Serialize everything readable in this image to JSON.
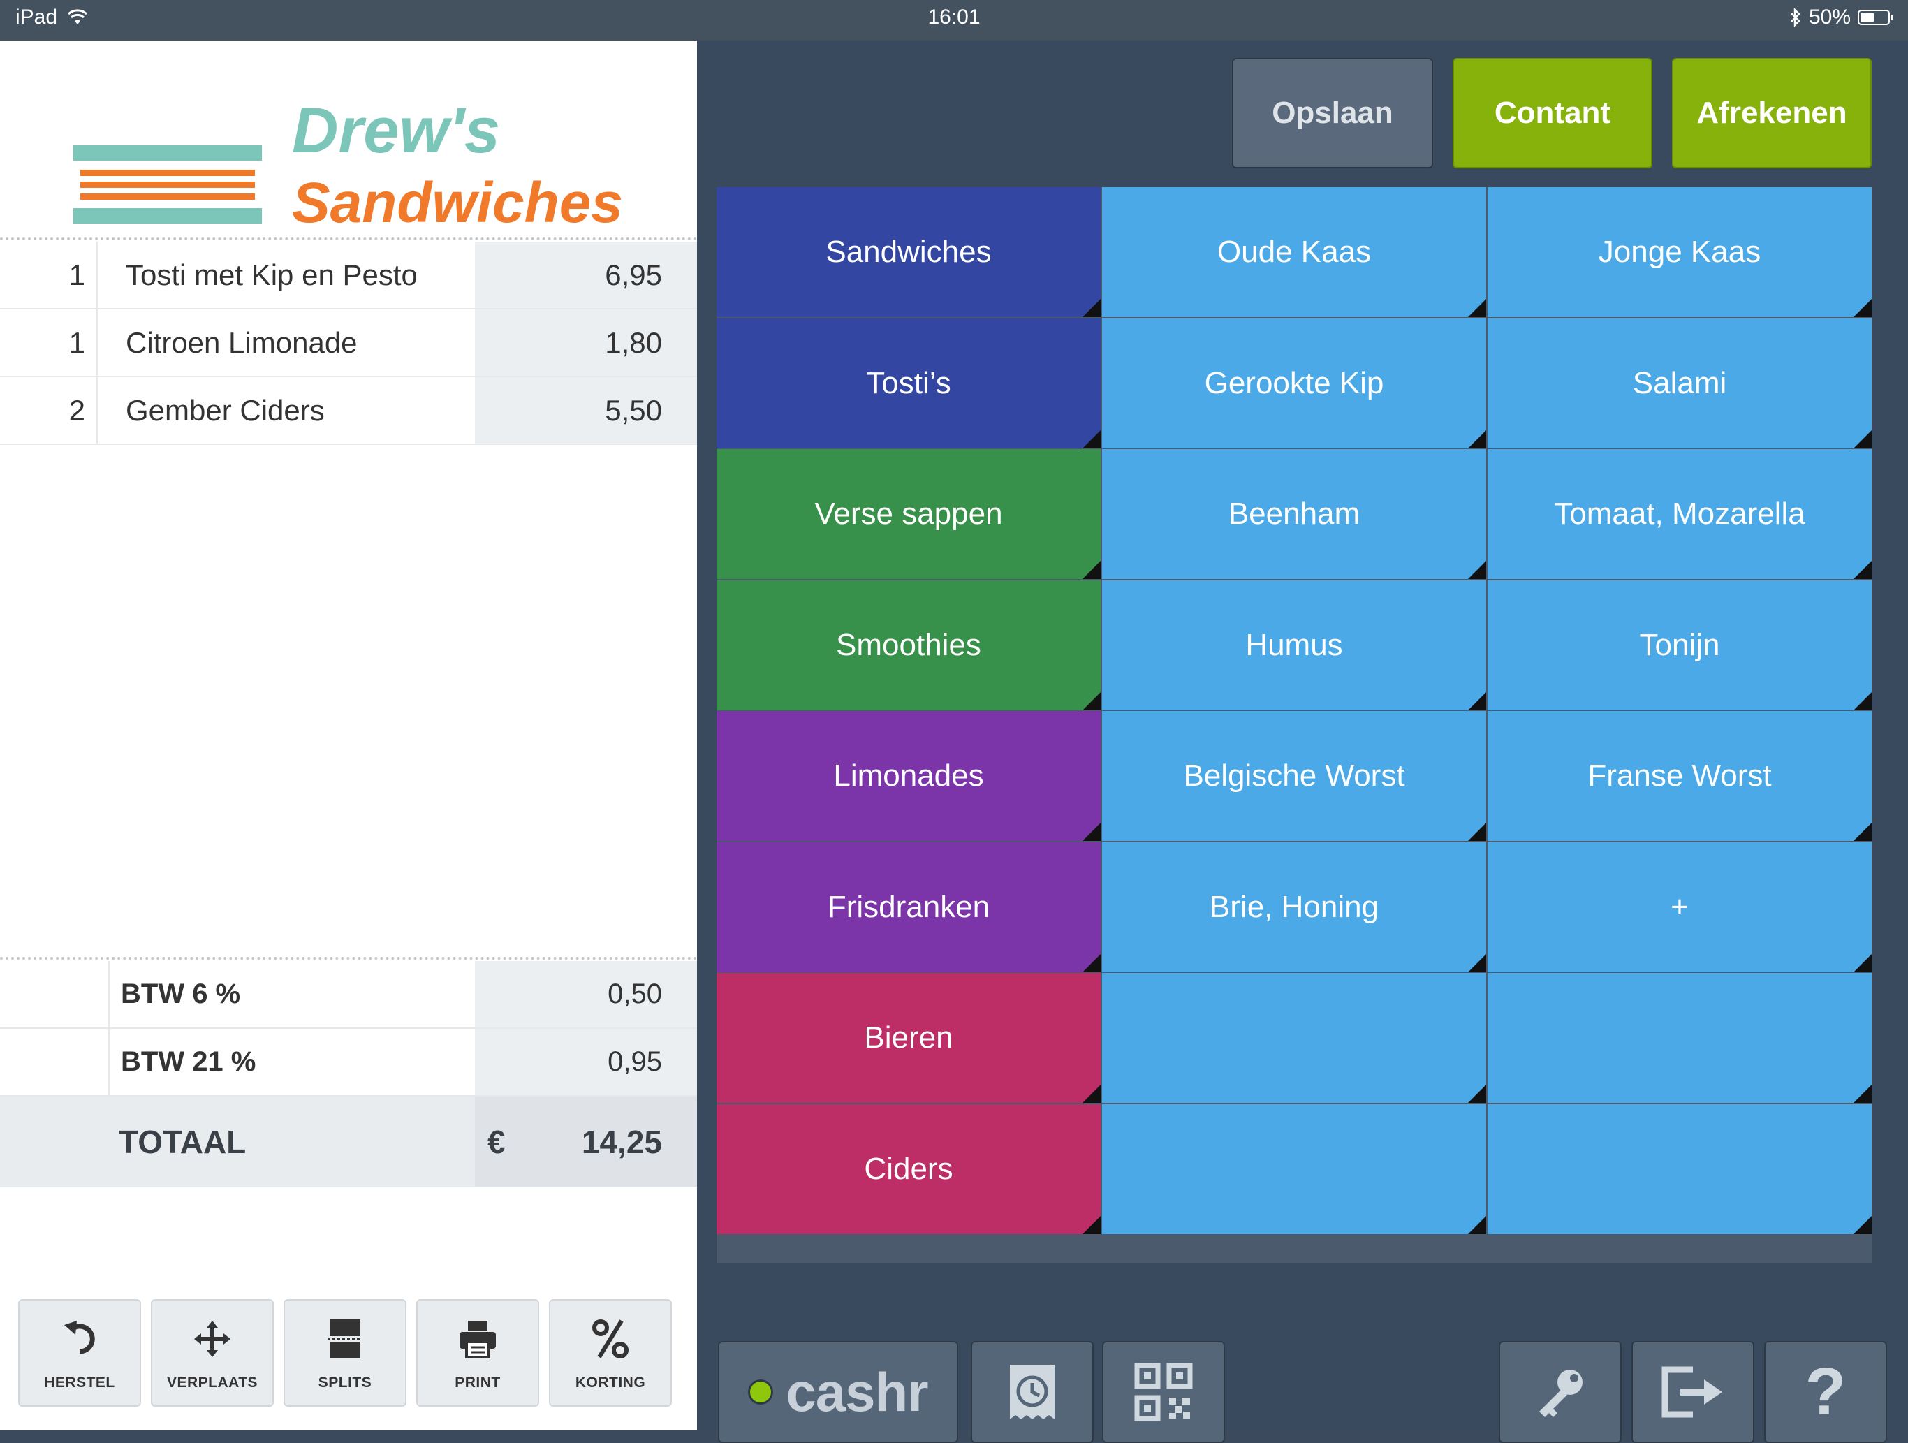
{
  "status_bar": {
    "device": "iPad",
    "time": "16:01",
    "battery": "50%",
    "battery_level": 0.5
  },
  "logo": {
    "line1": "Drew's",
    "line2": "Sandwiches"
  },
  "order_items": [
    {
      "qty": "1",
      "name": "Tosti met Kip en Pesto",
      "price": "6,95"
    },
    {
      "qty": "1",
      "name": "Citroen Limonade",
      "price": "1,80"
    },
    {
      "qty": "2",
      "name": "Gember Ciders",
      "price": "5,50"
    }
  ],
  "tax_rows": [
    {
      "label": "BTW 6 %",
      "value": "0,50"
    },
    {
      "label": "BTW 21 %",
      "value": "0,95"
    }
  ],
  "total": {
    "label": "TOTAAL",
    "currency": "€",
    "amount": "14,25"
  },
  "tools": [
    {
      "label": "HERSTEL",
      "icon": "undo-icon"
    },
    {
      "label": "VERPLAATS",
      "icon": "move-icon"
    },
    {
      "label": "SPLITS",
      "icon": "split-icon"
    },
    {
      "label": "PRINT",
      "icon": "printer-icon"
    },
    {
      "label": "KORTING",
      "icon": "percent-icon"
    }
  ],
  "actions": {
    "save": "Opslaan",
    "cash": "Contant",
    "checkout": "Afrekenen"
  },
  "categories": [
    {
      "label": "Sandwiches",
      "color": "#3347a2"
    },
    {
      "label": "Tosti’s",
      "color": "#3347a2"
    },
    {
      "label": "Verse sappen",
      "color": "#38914a"
    },
    {
      "label": "Smoothies",
      "color": "#38914a"
    },
    {
      "label": "Limonades",
      "color": "#7c35a8"
    },
    {
      "label": "Frisdranken",
      "color": "#7c35a8"
    },
    {
      "label": "Bieren",
      "color": "#bd2d66"
    },
    {
      "label": "Ciders",
      "color": "#bd2d66"
    }
  ],
  "products": [
    [
      "Oude Kaas",
      "Jonge Kaas"
    ],
    [
      "Gerookte Kip",
      "Salami"
    ],
    [
      "Beenham",
      "Tomaat, Mozarella"
    ],
    [
      "Humus",
      "Tonijn"
    ],
    [
      "Belgische Worst",
      "Franse Worst"
    ],
    [
      "Brie, Honing",
      "+"
    ],
    [
      "",
      ""
    ],
    [
      "",
      ""
    ]
  ],
  "product_color": "#4aa9e6",
  "bottom": {
    "brand": "cashr",
    "icons": [
      "receipt-clock-icon",
      "qr-code-icon",
      "key-icon",
      "logout-icon",
      "help-icon"
    ],
    "help": "?"
  }
}
